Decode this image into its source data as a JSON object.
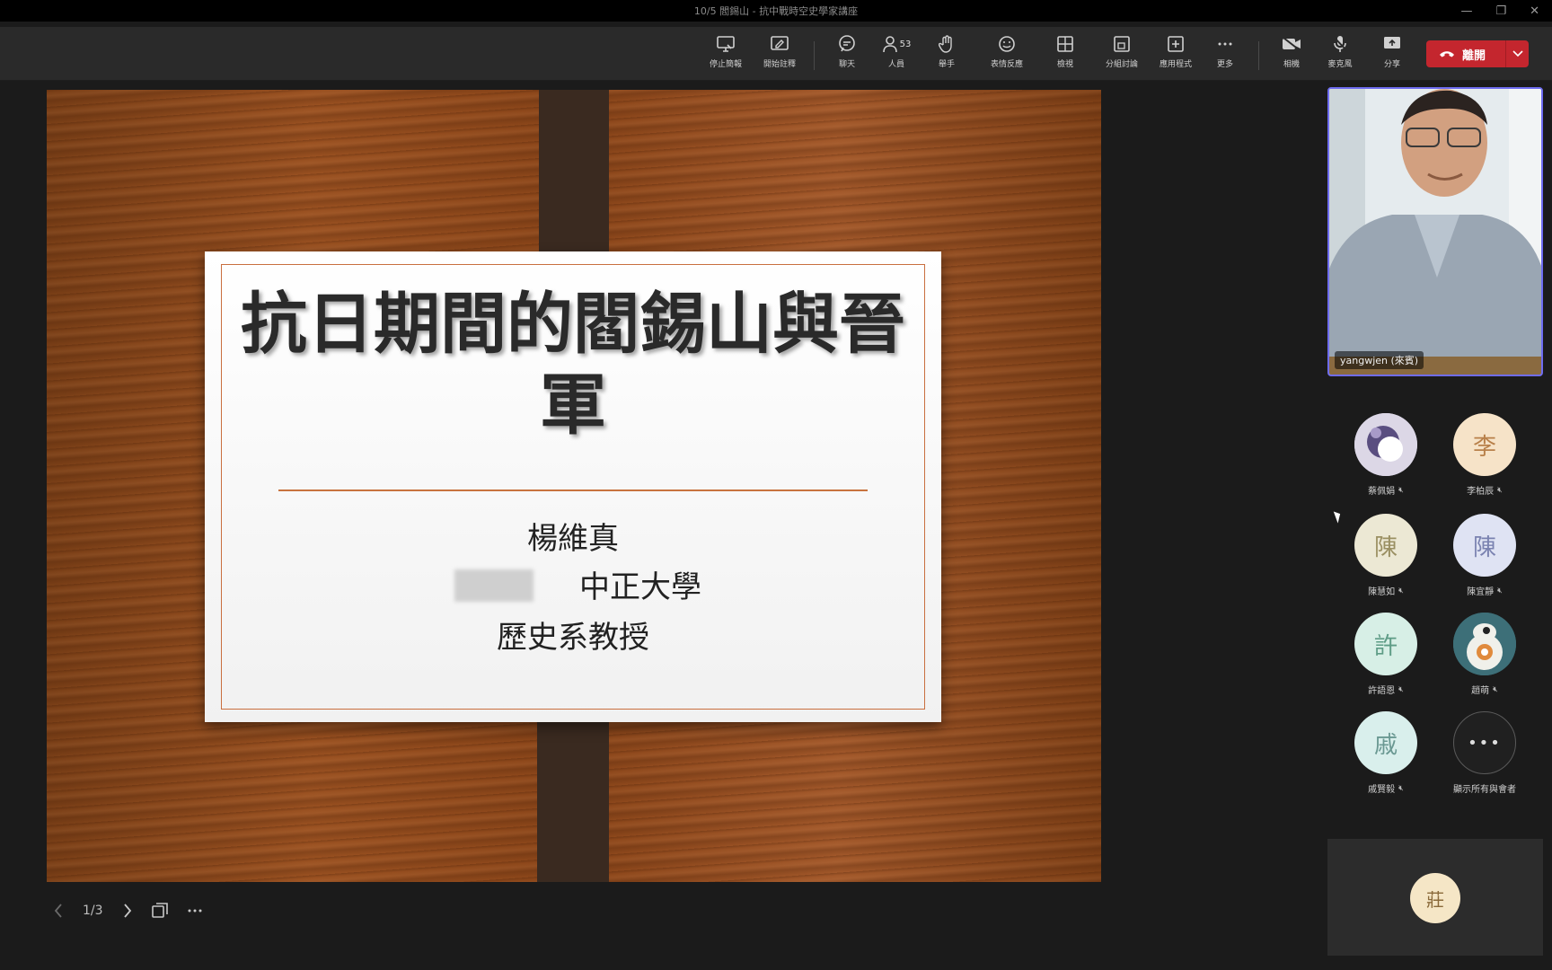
{
  "window": {
    "title": "10/5 閻錫山 - 抗中戰時空史學家講座",
    "controls": [
      "minimize-icon",
      "restore-icon",
      "close-icon"
    ]
  },
  "toolbar": {
    "items": [
      {
        "icon": "screen-share-icon",
        "label": "停止簡報"
      },
      {
        "icon": "annotate-icon",
        "label": "開始註釋"
      },
      {
        "icon": "chat-icon",
        "label": "聊天"
      },
      {
        "icon": "people-icon",
        "label": "人員",
        "count": "53"
      },
      {
        "icon": "raise-hand-icon",
        "label": "舉手"
      },
      {
        "icon": "reactions-icon",
        "label": "表情反應"
      },
      {
        "icon": "view-icon",
        "label": "檢視"
      },
      {
        "icon": "breakout-rooms-icon",
        "label": "分組討論"
      },
      {
        "icon": "apps-icon",
        "label": "應用程式"
      },
      {
        "icon": "more-icon",
        "label": "更多"
      },
      {
        "icon": "camera-off-icon",
        "label": "相機"
      },
      {
        "icon": "mic-off-icon",
        "label": "麥克風"
      },
      {
        "icon": "share-icon",
        "label": "分享"
      }
    ],
    "leave_label": "離開",
    "leave_color": "#c4262e"
  },
  "slide": {
    "title": "抗日期間的閻錫山與晉軍",
    "author": "楊維真",
    "affiliation": "中正大學",
    "position": "歷史系教授",
    "page": "1/3"
  },
  "self_video": {
    "name": "yangwjen (來賓)"
  },
  "participants": [
    {
      "initial": "",
      "name": "蔡佩娟",
      "avatar_bg": "#c9c3d6",
      "avatar_fg": "#4a4070",
      "image": true
    },
    {
      "initial": "李",
      "name": "李柏辰",
      "avatar_bg": "#f6e3c8",
      "avatar_fg": "#b8804a"
    },
    {
      "initial": "陳",
      "name": "陳慧如",
      "avatar_bg": "#ece8d4",
      "avatar_fg": "#9a8f62"
    },
    {
      "initial": "陳",
      "name": "陳宜靜",
      "avatar_bg": "#dfe3f3",
      "avatar_fg": "#7a82b0"
    },
    {
      "initial": "許",
      "name": "許語恩",
      "avatar_bg": "#d7efe6",
      "avatar_fg": "#5e9c86"
    },
    {
      "initial": "",
      "name": "趙萌",
      "avatar_bg": "#3d6f78",
      "avatar_fg": "#ffffff",
      "image": true
    },
    {
      "initial": "戚",
      "name": "戚賢毅",
      "avatar_bg": "#d9efec",
      "avatar_fg": "#6a9892"
    }
  ],
  "more_participants_label": "顯示所有與會者",
  "extra_participant": {
    "initial": "莊"
  }
}
